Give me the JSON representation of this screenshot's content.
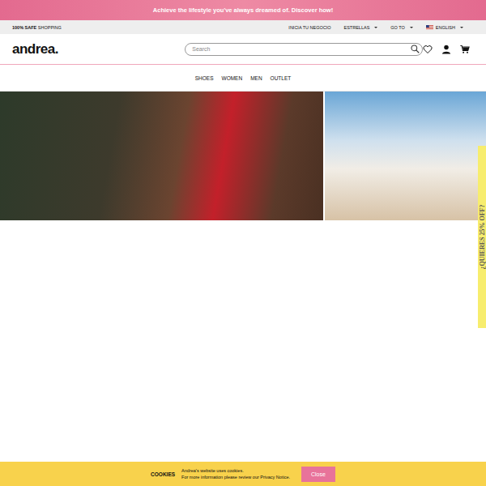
{
  "promo_bar": {
    "text": "Achieve the lifestyle you've always dreamed of. Discover how!"
  },
  "utility_bar": {
    "safe_bold": "100% SAFE",
    "safe_rest": "SHOPPING",
    "links": [
      {
        "label": "INICIA TU NEGOCIO",
        "dropdown": false
      },
      {
        "label": "ESTRELLAS",
        "dropdown": true
      },
      {
        "label": "GO TO",
        "dropdown": true
      }
    ],
    "language": {
      "label": "ENGLISH",
      "dropdown": true
    }
  },
  "header": {
    "logo": "andrea.",
    "search": {
      "placeholder": "Search"
    }
  },
  "nav": {
    "items": [
      "SHOES",
      "WOMEN",
      "MEN",
      "OUTLET"
    ]
  },
  "banners": [
    {
      "name": "discount-banner"
    },
    {
      "name": "summer-banner"
    }
  ],
  "side_tab": {
    "text": "¿QUIERES 25% OFF?"
  },
  "cookie_bar": {
    "title": "COOKIES",
    "lines": [
      "Andrea's website uses cookies.",
      "For more information please review our Privacy Notice."
    ],
    "button": "Close"
  }
}
